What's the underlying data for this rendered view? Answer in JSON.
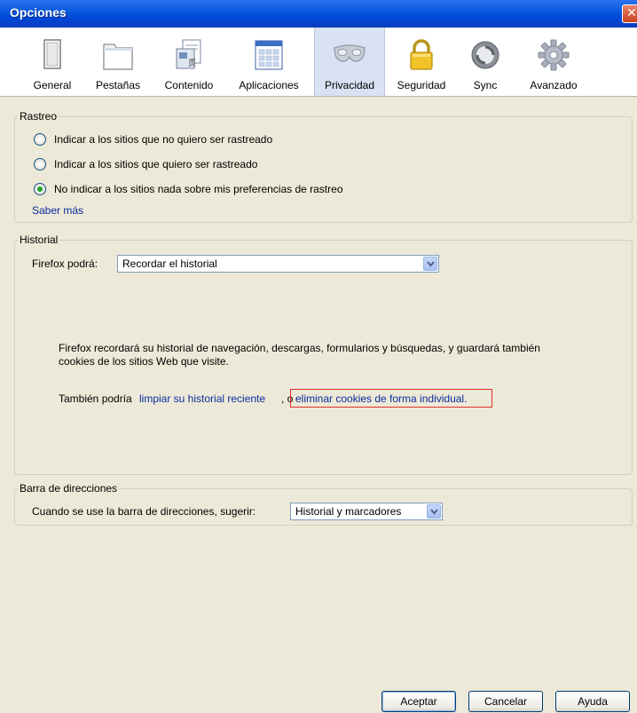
{
  "window": {
    "title": "Opciones",
    "close_glyph": "✕"
  },
  "toolbar": {
    "selected": "Privacidad",
    "items": [
      {
        "label": "General",
        "icon": "general-icon"
      },
      {
        "label": "Pestañas",
        "icon": "tabs-icon"
      },
      {
        "label": "Contenido",
        "icon": "content-icon"
      },
      {
        "label": "Aplicaciones",
        "icon": "applications-icon"
      },
      {
        "label": "Privacidad",
        "icon": "privacy-mask-icon"
      },
      {
        "label": "Seguridad",
        "icon": "security-lock-icon"
      },
      {
        "label": "Sync",
        "icon": "sync-icon"
      },
      {
        "label": "Avanzado",
        "icon": "advanced-gear-icon"
      }
    ]
  },
  "tracking": {
    "legend": "Rastreo",
    "options": [
      {
        "label": "Indicar a los sitios que no quiero ser rastreado",
        "selected": false
      },
      {
        "label": "Indicar a los sitios que quiero ser rastreado",
        "selected": false
      },
      {
        "label": "No indicar a los sitios nada sobre mis preferencias de rastreo",
        "selected": true
      }
    ],
    "learn_more": "Saber más"
  },
  "history": {
    "legend": "Historial",
    "label": "Firefox podrá:",
    "select_value": "Recordar el historial",
    "description_line1": "Firefox recordará su historial de navegación, descargas, formularios y búsquedas, y guardará también",
    "description_line2": "cookies de los sitios Web que visite.",
    "also_prefix": "También podría ",
    "clear_link": "limpiar su historial reciente",
    "or_text": ", o ",
    "cookies_link": "eliminar cookies de forma individual."
  },
  "location_bar": {
    "legend": "Barra de direcciones",
    "label": "Cuando se use la barra de direcciones, sugerir:",
    "select_value": "Historial y marcadores"
  },
  "buttons": {
    "ok": "Aceptar",
    "cancel": "Cancelar",
    "help": "Ayuda"
  },
  "colors": {
    "titlebar": "#0a5be0",
    "selected_tab": "#d9e2f2",
    "link": "#0b2c9e",
    "highlight_box": "#e0302a",
    "radio_dot": "#1fa323"
  }
}
